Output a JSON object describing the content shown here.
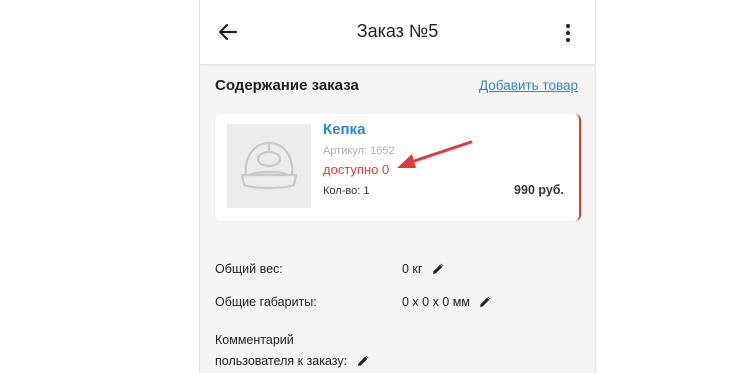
{
  "appbar": {
    "title": "Заказ №5",
    "back_icon": "arrow-back-icon",
    "menu_icon": "more-vertical-icon"
  },
  "order": {
    "section_title": "Содержание заказа",
    "add_link": "Добавить товар"
  },
  "product": {
    "name": "Кепка",
    "article": "Артикул: 1652",
    "availability": "доступно 0",
    "quantity": "Кол-во: 1",
    "price": "990 руб.",
    "image_icon": "cap-placeholder-icon"
  },
  "details": {
    "weight_label": "Общий вес:",
    "weight_value": "0 кг",
    "dims_label": "Общие габариты:",
    "dims_value": "0 x 0 x 0 мм",
    "comment_label_line1": "Комментарий",
    "comment_label_line2": "пользователя к заказу:"
  },
  "colors": {
    "accent": "#2b88d8",
    "error": "#e53935",
    "background": "#f5f5f5"
  }
}
